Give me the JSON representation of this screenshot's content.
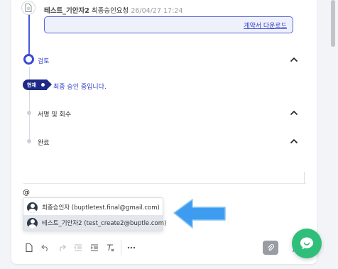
{
  "history_entry": {
    "author": "테스트_기안자2",
    "action": "최종승인요청",
    "timestamp": "26/04/27 17:24",
    "download_label": "계약서 다운로드"
  },
  "steps": [
    {
      "label": "검토",
      "state": "active"
    },
    {
      "label": "서명 및 회수",
      "state": "pending"
    },
    {
      "label": "완료",
      "state": "pending"
    }
  ],
  "current": {
    "badge": "현재",
    "message": "최종 승인 중입니다."
  },
  "comment": {
    "input_value": "@"
  },
  "mention_options": [
    {
      "label": "최종승인자 (buptletest.final@gmail.com)",
      "selected": false
    },
    {
      "label": "테스트_기안자2 (test_create2@buptle.com)",
      "selected": true
    }
  ],
  "toolbar": {
    "icons": [
      "document-icon",
      "undo-icon",
      "redo-icon",
      "outdent-icon",
      "indent-icon",
      "clear-format-icon",
      "more-icon"
    ],
    "attach_icon": "paperclip-icon"
  },
  "colors": {
    "accent": "#3a4ad6",
    "badge_bg": "#1e2a86",
    "chat_fab": "#2fbf7a",
    "arrow": "#3d9cf0"
  }
}
